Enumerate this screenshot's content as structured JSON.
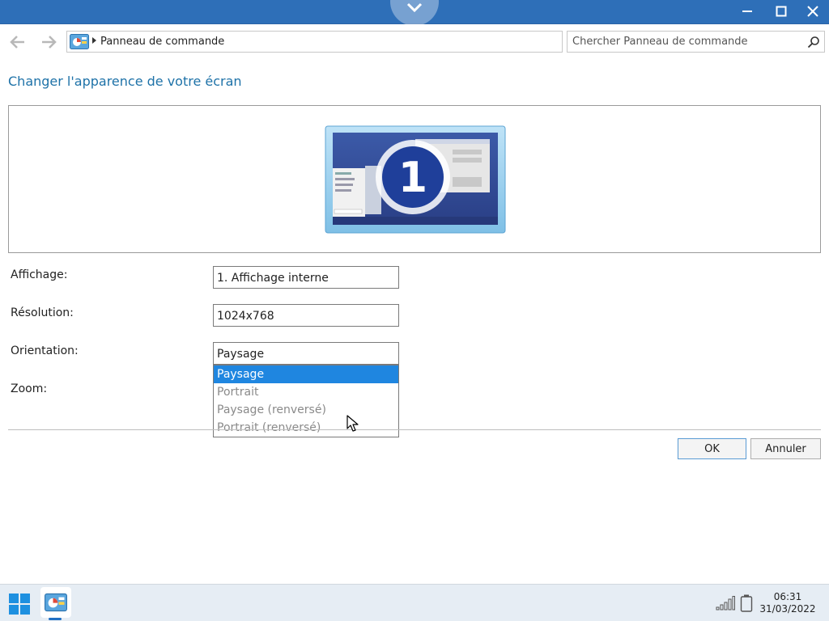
{
  "titlebar": {
    "pulldown_icon": "chevron-down-icon",
    "minimize_icon": "minimize-icon",
    "maximize_icon": "maximize-icon",
    "close_icon": "close-icon"
  },
  "nav": {
    "back_icon": "arrow-left-icon",
    "forward_icon": "arrow-right-icon"
  },
  "address": {
    "icon": "control-panel-icon",
    "text": "Panneau de commande"
  },
  "search": {
    "placeholder": "Chercher Panneau de commande",
    "icon": "search-icon"
  },
  "page": {
    "title": "Changer l'apparence de votre écran"
  },
  "preview": {
    "monitor_number": "1"
  },
  "form": {
    "display_label": "Affichage:",
    "display_value": "1. Affichage interne",
    "resolution_label": "Résolution:",
    "resolution_value": "1024x768",
    "orientation_label": "Orientation:",
    "orientation_value": "Paysage",
    "zoom_label": "Zoom:"
  },
  "orientation_options": [
    "Paysage",
    "Portrait",
    "Paysage (renversé)",
    "Portrait (renversé)"
  ],
  "orientation_selected_index": 0,
  "buttons": {
    "ok": "OK",
    "cancel": "Annuler"
  },
  "taskbar": {
    "start_icon": "windows-start-icon",
    "app_icon": "control-panel-icon",
    "time": "06:31",
    "date": "31/03/2022"
  },
  "colors": {
    "titlebar": "#2e6fb8",
    "accent": "#1f86e0",
    "title_text": "#1e72a8"
  }
}
